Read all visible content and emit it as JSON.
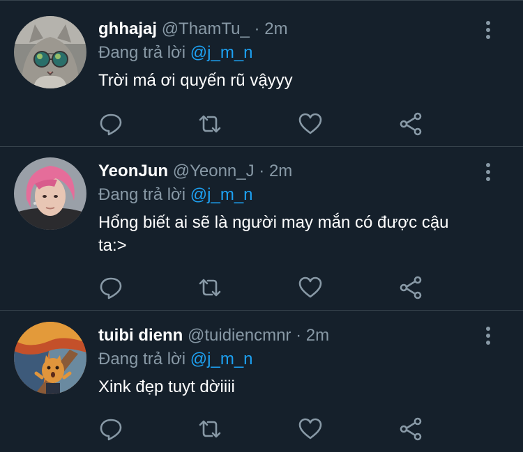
{
  "tweets": [
    {
      "name": "ghhajaj",
      "handle": "@ThamTu_",
      "separator": "·",
      "time": "2m",
      "reply_prefix": "Đang trả lời",
      "reply_to": "@j_m_n",
      "text": "Trời má ơi quyến rũ vậyyy",
      "avatar_icon": "cat-sunglasses-avatar"
    },
    {
      "name": "YeonJun",
      "handle": "@Yeonn_J",
      "separator": "·",
      "time": "2m",
      "reply_prefix": "Đang trả lời",
      "reply_to": "@j_m_n",
      "text": "Hổng biết ai sẽ là người may mắn có được cậu ta:>",
      "avatar_icon": "pink-hair-person-avatar"
    },
    {
      "name": "tuibi dienn",
      "handle": "@tuidiencmnr",
      "separator": "·",
      "time": "2m",
      "reply_prefix": "Đang trả lời",
      "reply_to": "@j_m_n",
      "text": "Xink đẹp tuyt dờiiii",
      "avatar_icon": "scream-painting-cat-avatar"
    }
  ],
  "actions": [
    "reply-icon",
    "retweet-icon",
    "like-icon",
    "share-icon"
  ],
  "colors": {
    "background": "#15202b",
    "divider": "#38444d",
    "secondary_text": "#8899a6",
    "mention": "#1da1f2",
    "primary_text": "#ffffff"
  }
}
